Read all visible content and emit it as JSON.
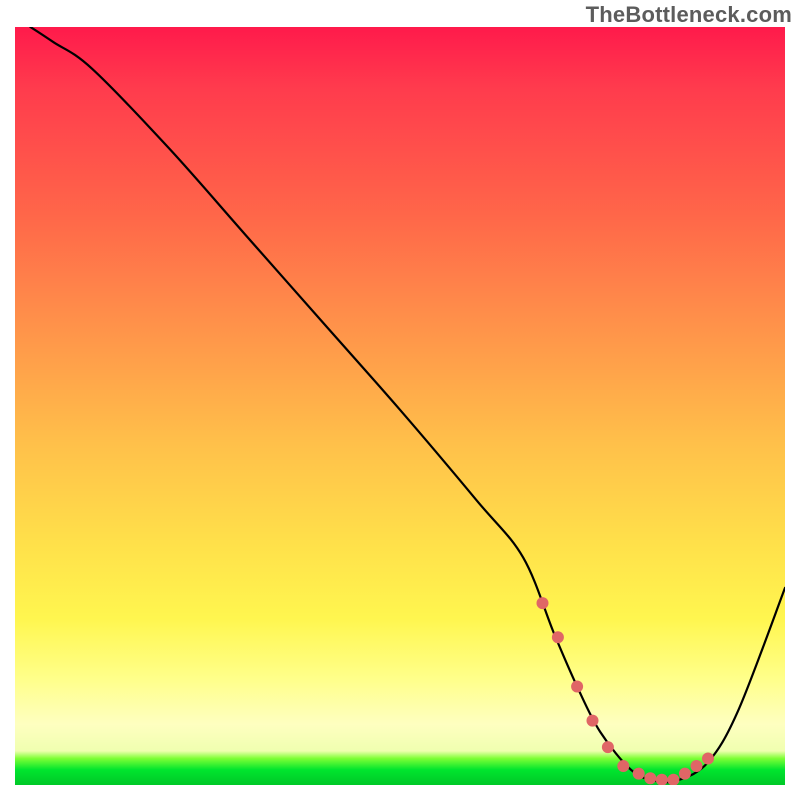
{
  "watermark": "TheBottleneck.com",
  "chart_data": {
    "type": "line",
    "title": "",
    "xlabel": "",
    "ylabel": "",
    "xlim": [
      0,
      100
    ],
    "ylim": [
      0,
      100
    ],
    "series": [
      {
        "name": "bottleneck-curve",
        "x": [
          2,
          5,
          10,
          20,
          30,
          40,
          50,
          60,
          66,
          70,
          73,
          76,
          80,
          83,
          86,
          90,
          94,
          100
        ],
        "y": [
          100,
          98,
          94.5,
          84,
          72.5,
          61,
          49.5,
          37.5,
          30,
          20,
          13,
          7,
          2,
          0.6,
          0.6,
          3,
          10,
          26
        ]
      }
    ],
    "markers": {
      "name": "optimal-range-markers",
      "color_hex": "#e06666",
      "x": [
        68.5,
        70.5,
        73,
        75,
        77,
        79,
        81,
        82.5,
        84,
        85.5,
        87,
        88.5,
        90
      ],
      "y": [
        24,
        19.5,
        13,
        8.5,
        5,
        2.5,
        1.5,
        0.9,
        0.7,
        0.7,
        1.5,
        2.5,
        3.5
      ]
    },
    "background_gradient": {
      "top_color_hex": "#ff1a4b",
      "mid_color_hex": "#ffe04a",
      "bottom_color_hex": "#00c828"
    }
  }
}
